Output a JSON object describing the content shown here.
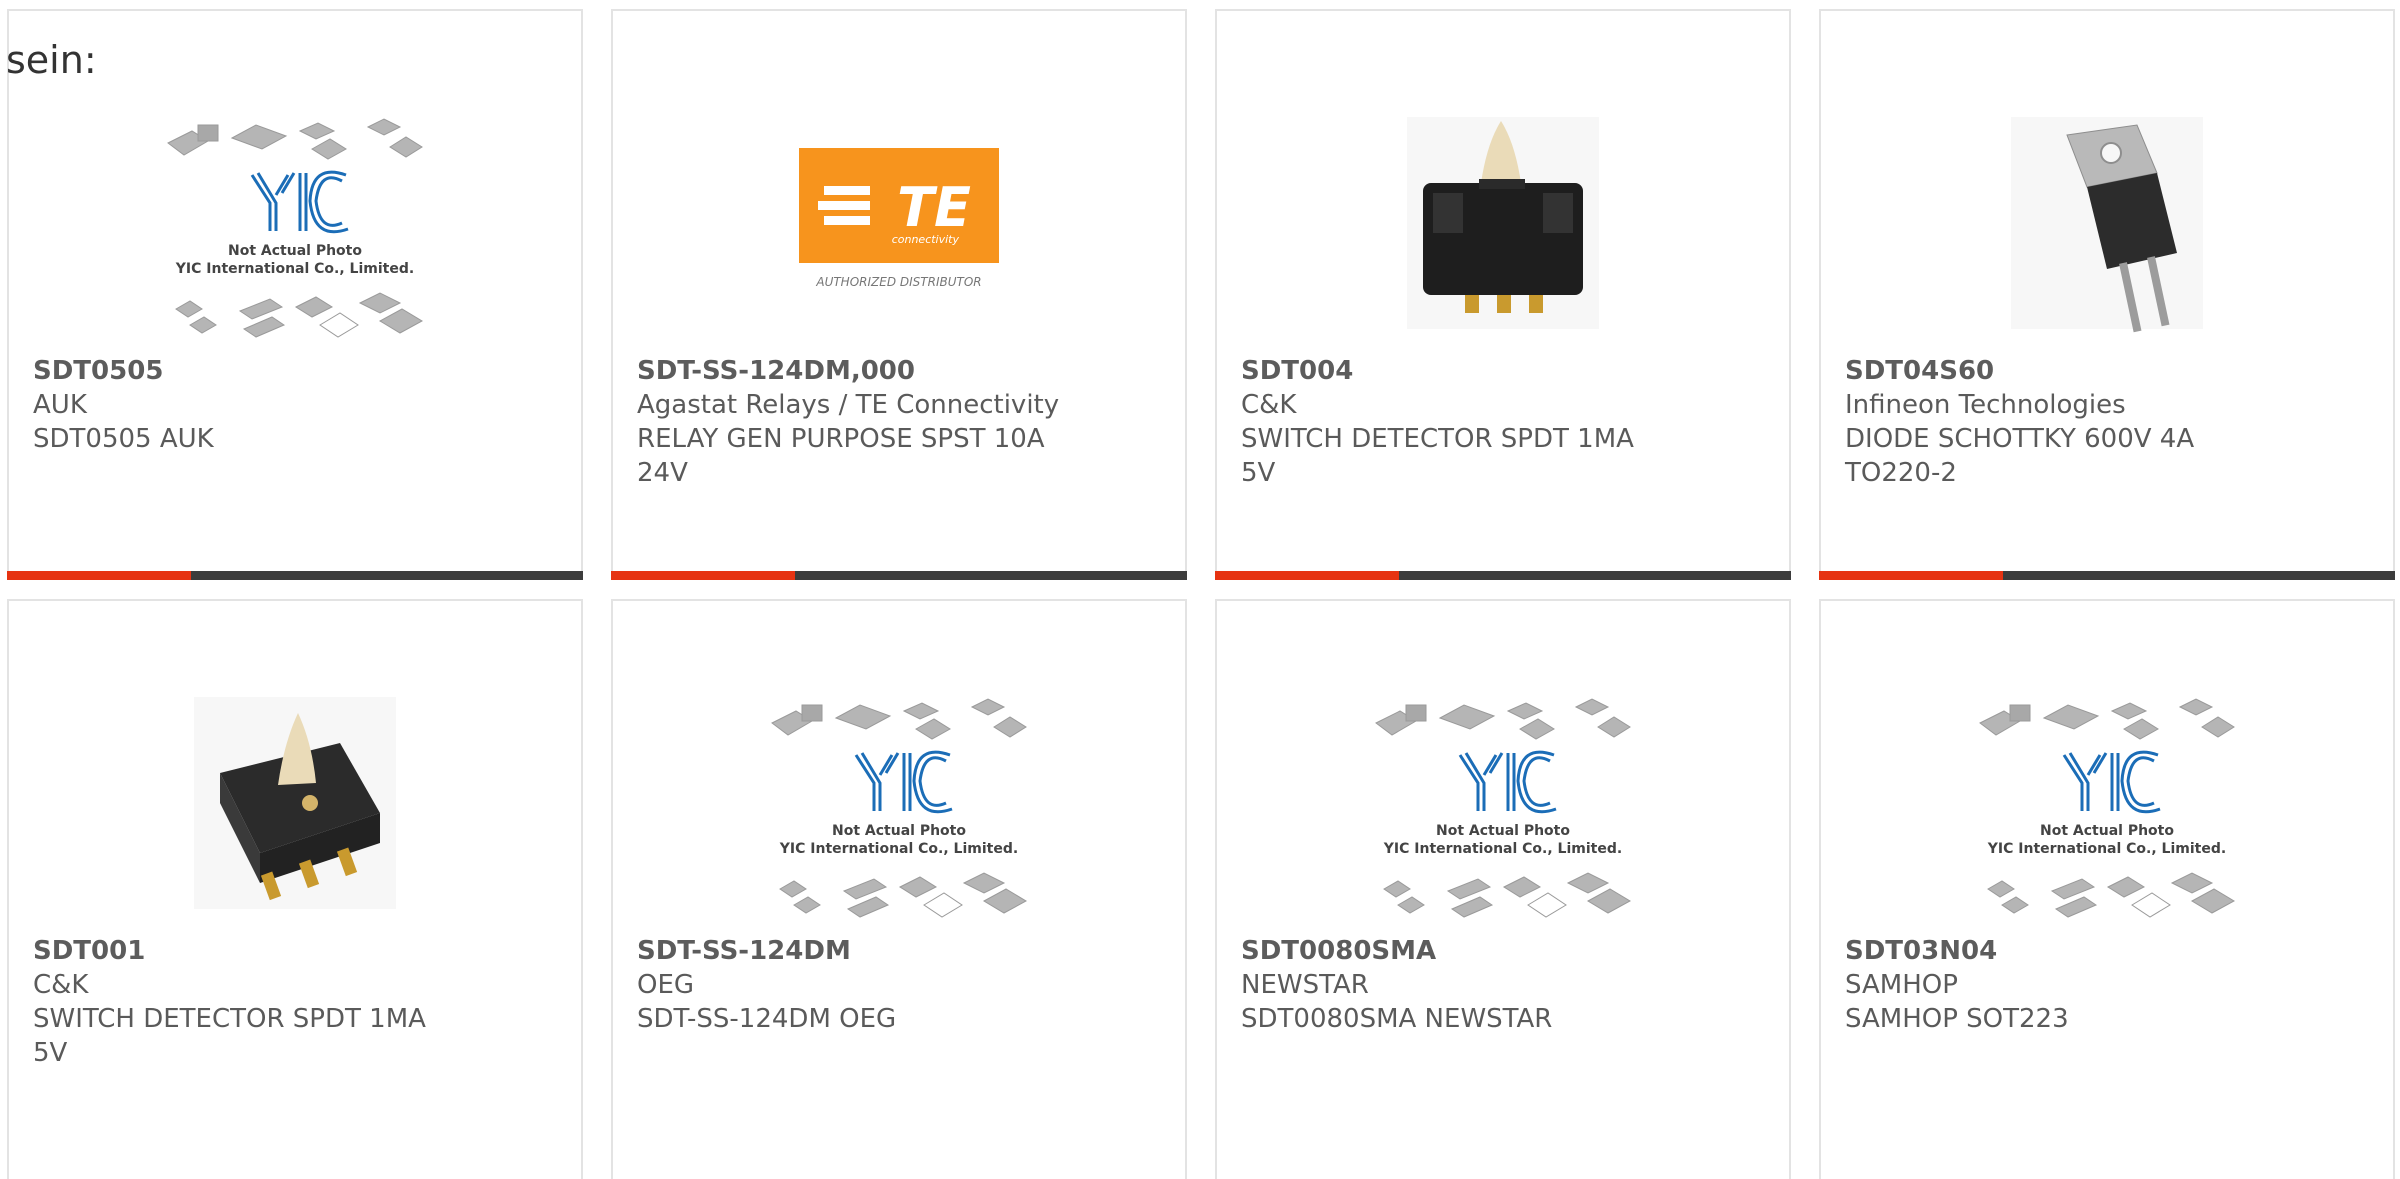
{
  "intro_text": "sein:",
  "colors": {
    "accent": "#e63312",
    "bar": "#3c3c3c",
    "border": "#e3e3e3",
    "yic_blue": "#1b6db7",
    "te_orange": "#f7941d"
  },
  "placeholder": {
    "caption_line1": "Not Actual Photo",
    "caption_line2": "YIC International Co., Limited.",
    "logo_text": "YIC"
  },
  "te_logo": {
    "word": "TE",
    "sub": "connectivity",
    "tagline": "AUTHORIZED DISTRIBUTOR"
  },
  "products": [
    {
      "part": "SDT0505",
      "manufacturer": "AUK",
      "description": "SDT0505 AUK",
      "image": "yic-placeholder",
      "progress": 0.32
    },
    {
      "part": "SDT-SS-124DM,000",
      "manufacturer": "Agastat Relays / TE Connectivity",
      "description": "RELAY GEN PURPOSE SPST 10A 24V",
      "image": "te-logo",
      "progress": 0.32
    },
    {
      "part": "SDT004",
      "manufacturer": "C&K",
      "description": "SWITCH DETECTOR SPDT 1MA 5V",
      "image": "switch-front",
      "progress": 0.32
    },
    {
      "part": "SDT04S60",
      "manufacturer": "Infineon Technologies",
      "description": "DIODE SCHOTTKY 600V 4A TO220-2",
      "image": "to220",
      "progress": 0.32
    },
    {
      "part": "SDT001",
      "manufacturer": "C&K",
      "description": "SWITCH DETECTOR SPDT 1MA 5V",
      "image": "switch-angle"
    },
    {
      "part": "SDT-SS-124DM",
      "manufacturer": "OEG",
      "description": "SDT-SS-124DM OEG",
      "image": "yic-placeholder"
    },
    {
      "part": "SDT0080SMA",
      "manufacturer": "NEWSTAR",
      "description": "SDT0080SMA NEWSTAR",
      "image": "yic-placeholder"
    },
    {
      "part": "SDT03N04",
      "manufacturer": "SAMHOP",
      "description": "SAMHOP SOT223",
      "image": "yic-placeholder"
    }
  ]
}
